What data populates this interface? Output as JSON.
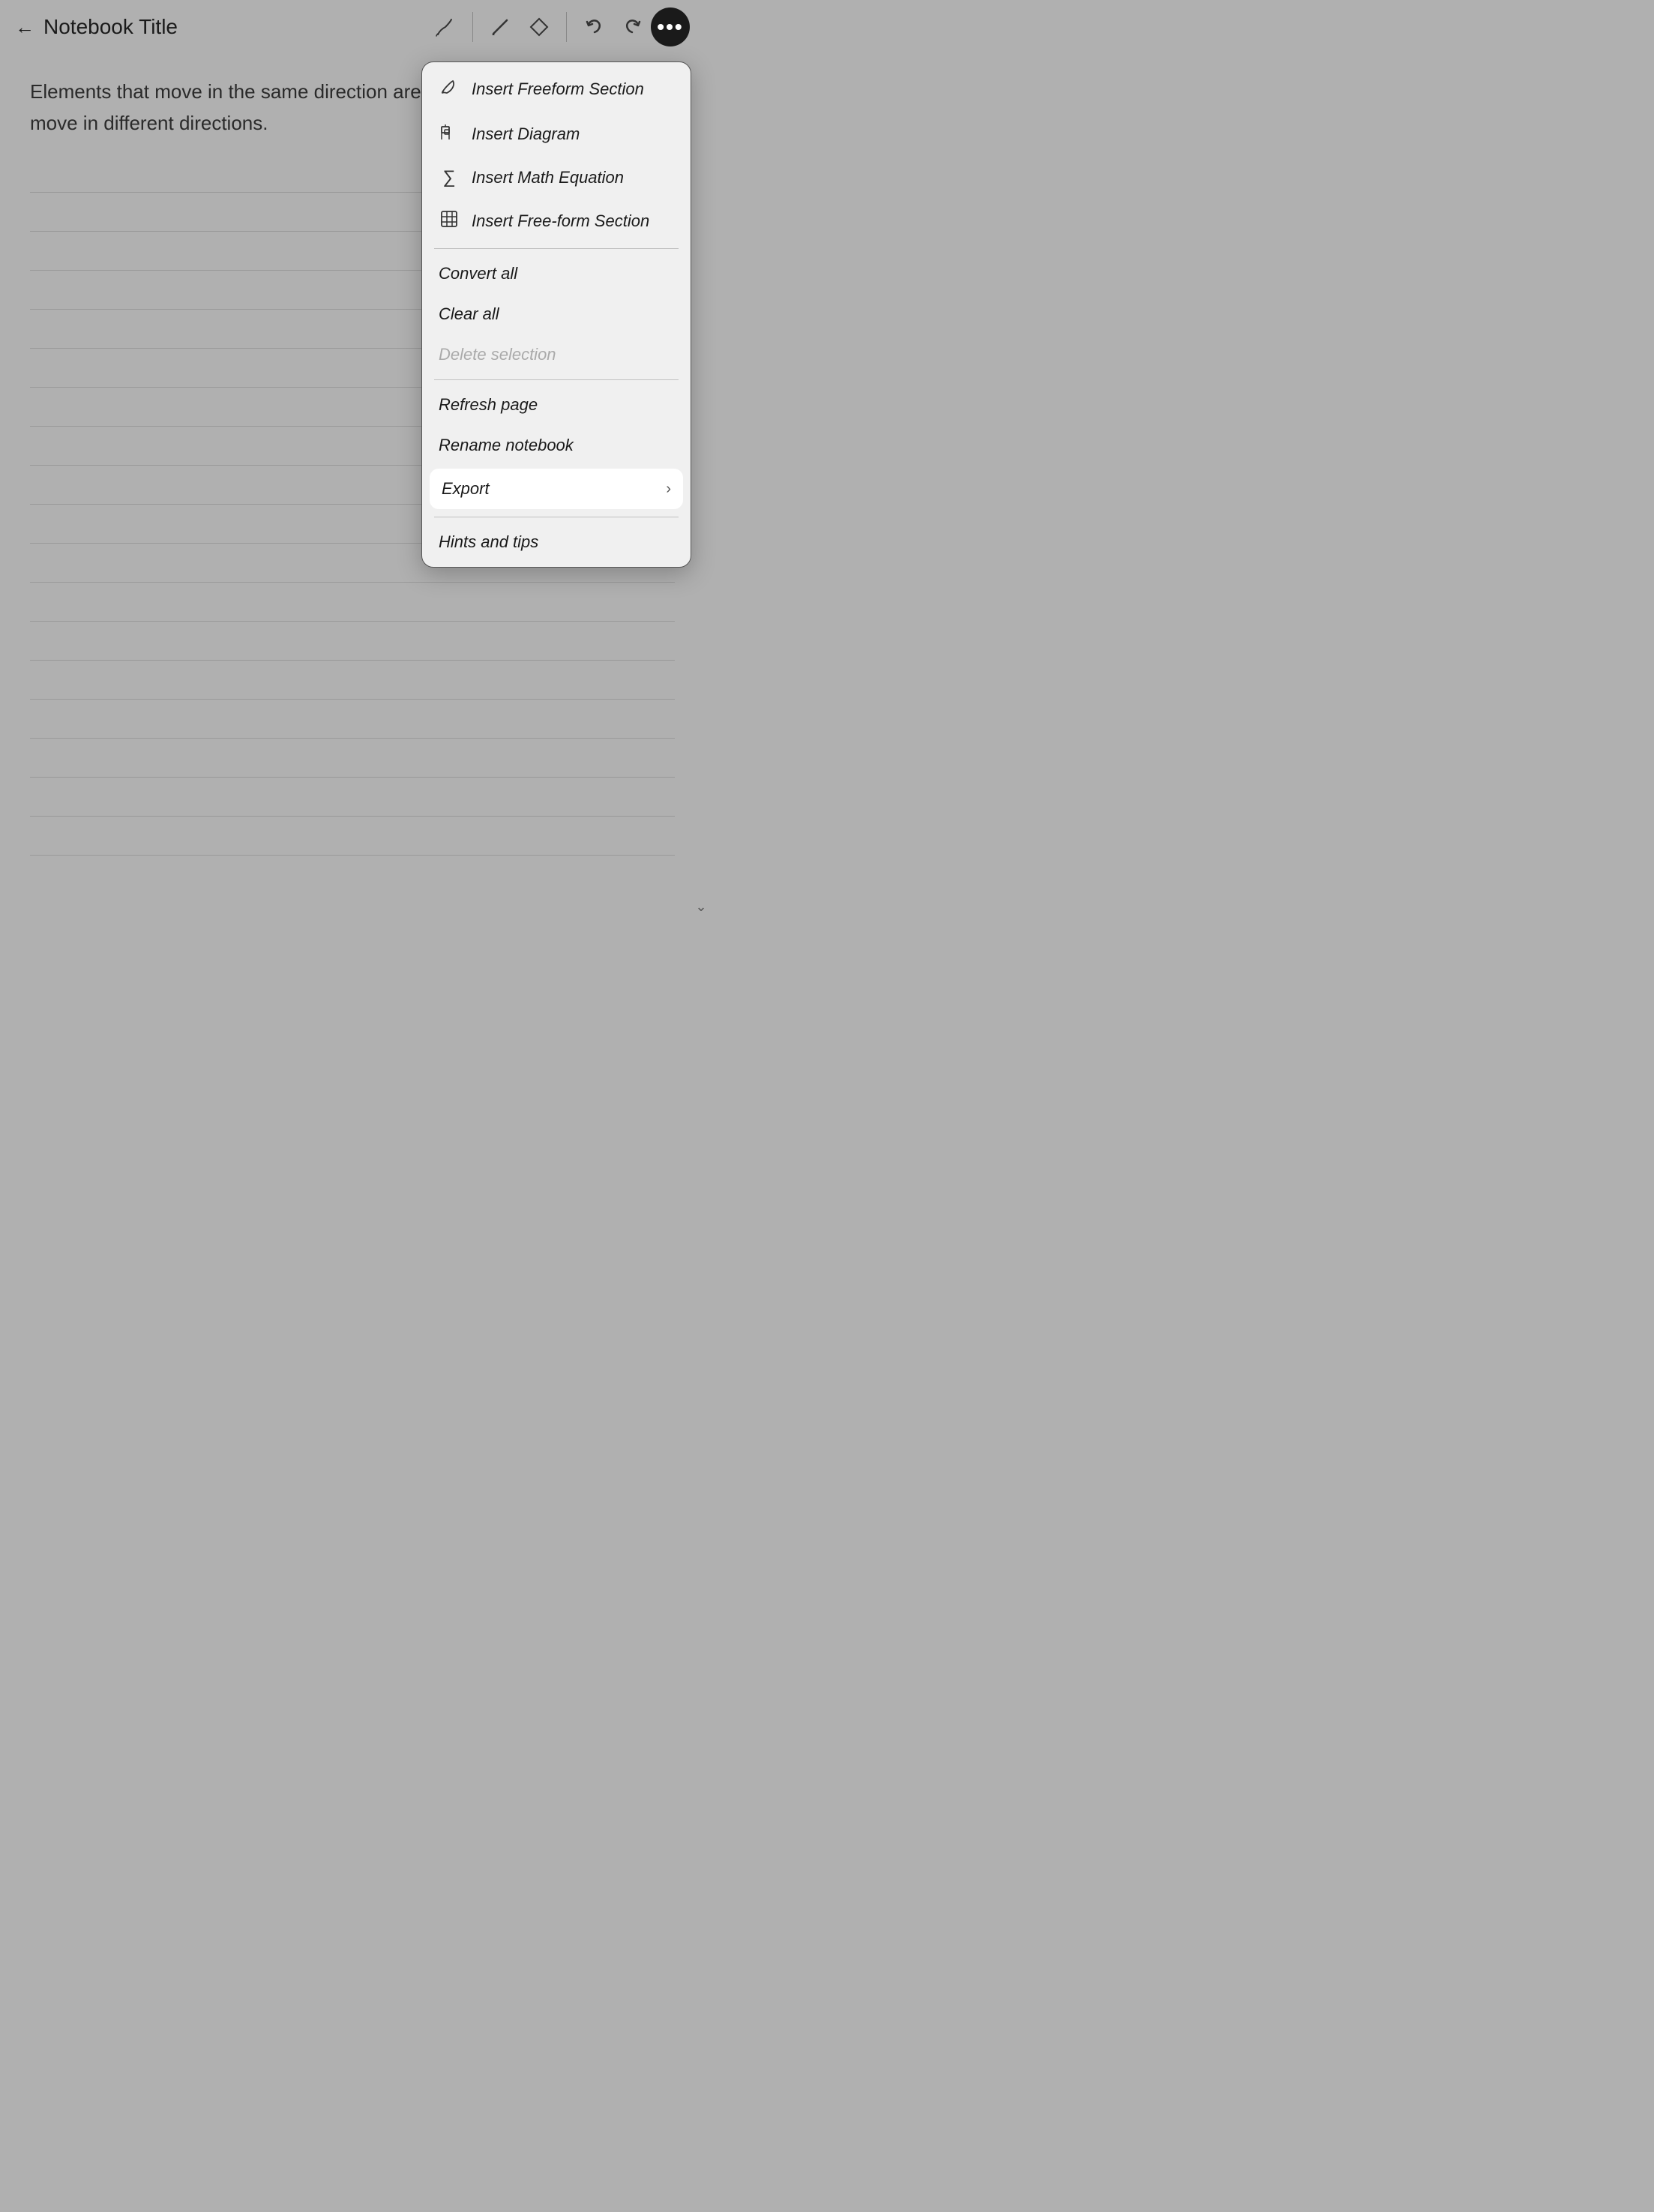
{
  "toolbar": {
    "back_label": "←",
    "title": "Notebook Title",
    "pen_icon": "pen-icon",
    "eraser_icon": "eraser-icon",
    "undo_icon": "undo-icon",
    "redo_icon": "redo-icon",
    "more_dots": "•••"
  },
  "content": {
    "text": "Elements that move in the same direction are perceiv that are stationary or move in different directions."
  },
  "menu": {
    "items": [
      {
        "id": "insert-freeform-section",
        "label": "Insert Freeform Section",
        "icon": "freeform",
        "disabled": false,
        "hasChevron": false,
        "highlighted": false
      },
      {
        "id": "insert-diagram",
        "label": "Insert Diagram",
        "icon": "diagram",
        "disabled": false,
        "hasChevron": false,
        "highlighted": false
      },
      {
        "id": "insert-math-equation",
        "label": "Insert Math Equation",
        "icon": "sigma",
        "disabled": false,
        "hasChevron": false,
        "highlighted": false
      },
      {
        "id": "insert-free-form-section",
        "label": "Insert Free-form Section",
        "icon": "grid",
        "disabled": false,
        "hasChevron": false,
        "highlighted": false
      },
      {
        "id": "convert-all",
        "label": "Convert all",
        "icon": "",
        "disabled": false,
        "hasChevron": false,
        "highlighted": false
      },
      {
        "id": "clear-all",
        "label": "Clear all",
        "icon": "",
        "disabled": false,
        "hasChevron": false,
        "highlighted": false
      },
      {
        "id": "delete-selection",
        "label": "Delete selection",
        "icon": "",
        "disabled": true,
        "hasChevron": false,
        "highlighted": false
      },
      {
        "id": "refresh-page",
        "label": "Refresh page",
        "icon": "",
        "disabled": false,
        "hasChevron": false,
        "highlighted": false
      },
      {
        "id": "rename-notebook",
        "label": "Rename notebook",
        "icon": "",
        "disabled": false,
        "hasChevron": false,
        "highlighted": false
      },
      {
        "id": "export",
        "label": "Export",
        "icon": "",
        "disabled": false,
        "hasChevron": true,
        "highlighted": true
      },
      {
        "id": "hints-and-tips",
        "label": "Hints and tips",
        "icon": "",
        "disabled": false,
        "hasChevron": false,
        "highlighted": false
      }
    ]
  }
}
